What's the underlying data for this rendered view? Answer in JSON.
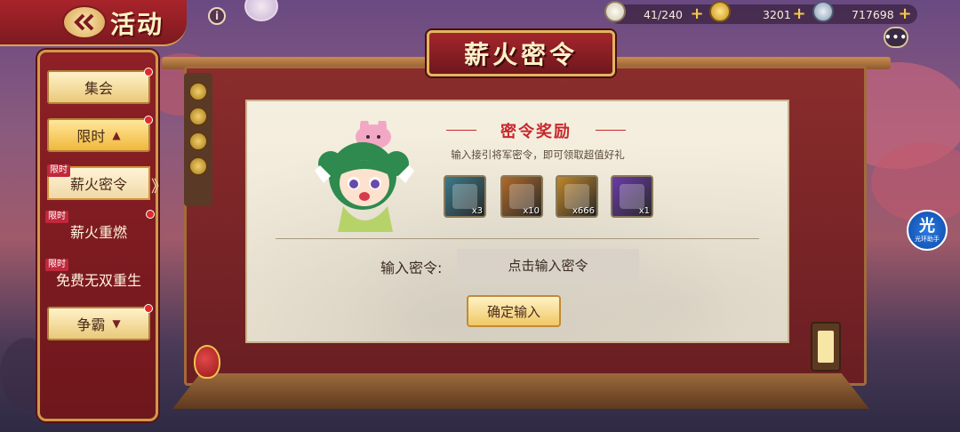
{
  "header": {
    "back_icon": "double-chevron-left-icon",
    "title": "活动",
    "info_icon": "i"
  },
  "resources": [
    {
      "name": "stamina",
      "icon": "steamed-bun-icon",
      "value": "41/240",
      "color": "#e9e4d8"
    },
    {
      "name": "gold",
      "icon": "gold-ingot-icon",
      "value": "3201",
      "color": "#f2c24a"
    },
    {
      "name": "silver",
      "icon": "silver-coin-icon",
      "value": "717698",
      "color": "#b9c6d8"
    }
  ],
  "chat_icon": "•••",
  "menu": {
    "tabs": [
      {
        "label": "集会",
        "dot": true
      },
      {
        "label": "限时",
        "dot": true,
        "arrow": "▲"
      },
      {
        "label": "争霸",
        "dot": true,
        "arrow": "▼"
      }
    ],
    "subitems": [
      {
        "tag": "限时",
        "label": "薪火密令",
        "selected": true
      },
      {
        "tag": "限时",
        "label": "薪火重燃",
        "dot": true
      },
      {
        "tag": "限时",
        "label": "免费无双重生",
        "dot": true
      }
    ],
    "selected_chevron": "》"
  },
  "panel": {
    "title": "薪火密令",
    "reward_title": "密令奖励",
    "reward_desc": "输入接引将军密令，即可领取超值好礼",
    "items": [
      {
        "icon": "jade-token-icon",
        "qty": "x3",
        "bg": "#3a7a8a"
      },
      {
        "icon": "scroll-icon",
        "qty": "x10",
        "bg": "#b06a2a"
      },
      {
        "icon": "gold-ingot-icon",
        "qty": "x666",
        "bg": "#c0862a"
      },
      {
        "icon": "purple-frame-icon",
        "qty": "x1",
        "bg": "#6a3aa8"
      }
    ],
    "code_label": "输入密令:",
    "code_placeholder": "点击输入密令",
    "confirm_label": "确定输入"
  },
  "guide_badge": {
    "glyph": "光",
    "caption": "光环助手"
  }
}
